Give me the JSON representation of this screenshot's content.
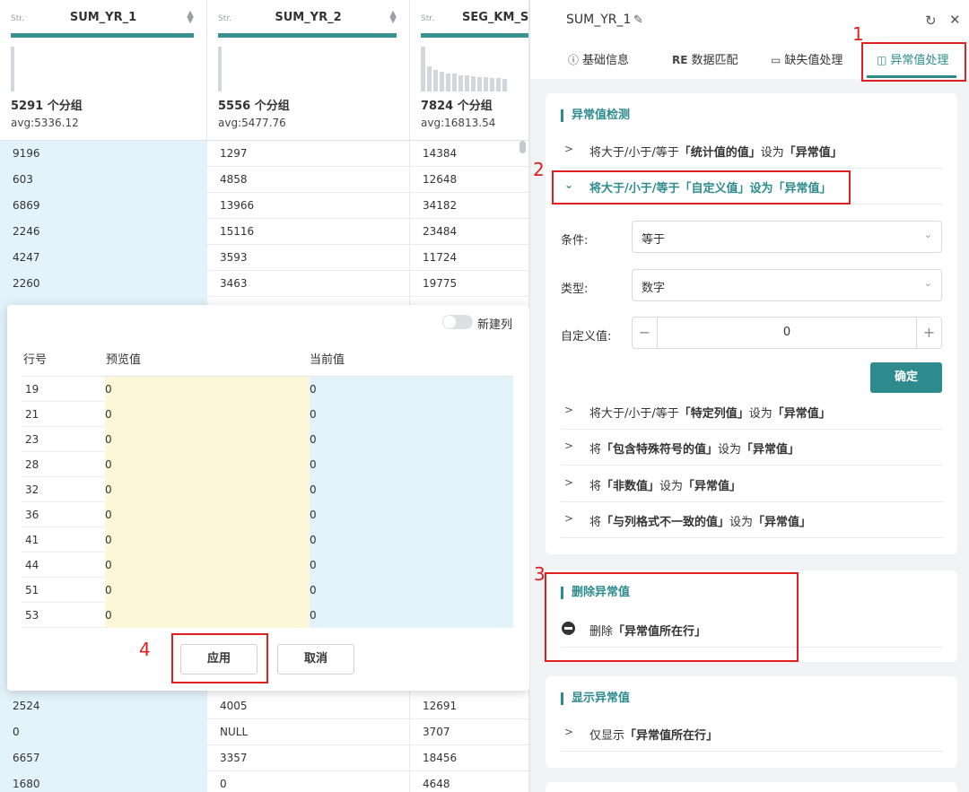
{
  "table": {
    "columns": [
      {
        "type": "Str.",
        "name": "SUM_YR_1",
        "groups": "5291 个分组",
        "avg": "avg:5336.12"
      },
      {
        "type": "Str.",
        "name": "SUM_YR_2",
        "groups": "5556 个分组",
        "avg": "avg:5477.76"
      },
      {
        "type": "Str.",
        "name": "SEG_KM_S",
        "groups": "7824 个分组",
        "avg": "avg:16813.54"
      }
    ],
    "rows_top": [
      [
        "9196",
        "1297",
        "14384"
      ],
      [
        "603",
        "4858",
        "12648"
      ],
      [
        "6869",
        "13966",
        "34182"
      ],
      [
        "2246",
        "15116",
        "23484"
      ],
      [
        "4247",
        "3593",
        "11724"
      ],
      [
        "2260",
        "3463",
        "19775"
      ]
    ],
    "rows_bottom": [
      [
        "2524",
        "4005",
        "12691"
      ],
      [
        "0",
        "NULL",
        "3707"
      ],
      [
        "6657",
        "3357",
        "18456"
      ],
      [
        "1680",
        "0",
        "4648"
      ]
    ]
  },
  "preview": {
    "new_column_label": "新建列",
    "new_column_on": false,
    "headers": {
      "row": "行号",
      "preview": "预览值",
      "current": "当前值"
    },
    "rows": [
      [
        "19",
        "0",
        "0"
      ],
      [
        "21",
        "0",
        "0"
      ],
      [
        "23",
        "0",
        "0"
      ],
      [
        "28",
        "0",
        "0"
      ],
      [
        "32",
        "0",
        "0"
      ],
      [
        "36",
        "0",
        "0"
      ],
      [
        "41",
        "0",
        "0"
      ],
      [
        "44",
        "0",
        "0"
      ],
      [
        "51",
        "0",
        "0"
      ],
      [
        "53",
        "0",
        "0"
      ]
    ],
    "apply_label": "应用",
    "cancel_label": "取消"
  },
  "panel": {
    "column_name": "SUM_YR_1",
    "tabs": [
      {
        "icon": "ⓘ",
        "label": "基础信息"
      },
      {
        "icon": "R͏E",
        "label": "数据匹配"
      },
      {
        "icon": "▭",
        "label": "缺失值处理"
      },
      {
        "icon": "◫",
        "label": "异常值处理"
      }
    ],
    "active_tab": "异常值处理",
    "detect": {
      "title": "异常值检测",
      "item_stat": {
        "prefix": "将大于/小于/等于",
        "b1": "「统计值的值」",
        "mid": "设为",
        "b2": "「异常值」"
      },
      "item_custom": "将大于/小于/等于「自定义值」设为「异常值」",
      "condition_label": "条件:",
      "condition_value": "等于",
      "type_label": "类型:",
      "type_value": "数字",
      "custom_label": "自定义值:",
      "custom_value": "0",
      "confirm_label": "确定",
      "item_col": {
        "prefix": "将大于/小于/等于",
        "b1": "「特定列值」",
        "mid": "设为",
        "b2": "「异常值」"
      },
      "item_special": {
        "prefix": "将",
        "b1": "「包含特殊符号的值」",
        "mid": "设为",
        "b2": "「异常值」"
      },
      "item_nonnum": {
        "prefix": "将",
        "b1": "「非数值」",
        "mid": "设为",
        "b2": "「异常值」"
      },
      "item_format": {
        "prefix": "将",
        "b1": "「与列格式不一致的值」",
        "mid": "设为",
        "b2": "「异常值」"
      }
    },
    "delete": {
      "title": "删除异常值",
      "item": {
        "prefix": "删除",
        "b1": "「异常值所在行」"
      }
    },
    "show": {
      "title": "显示异常值",
      "item": {
        "prefix": "仅显示",
        "b1": "「异常值所在行」"
      }
    }
  },
  "annotations": {
    "n1": "1",
    "n2": "2",
    "n3": "3",
    "n4": "4"
  },
  "colors": {
    "accent": "#2d8b8d",
    "annotation": "#e02020"
  }
}
